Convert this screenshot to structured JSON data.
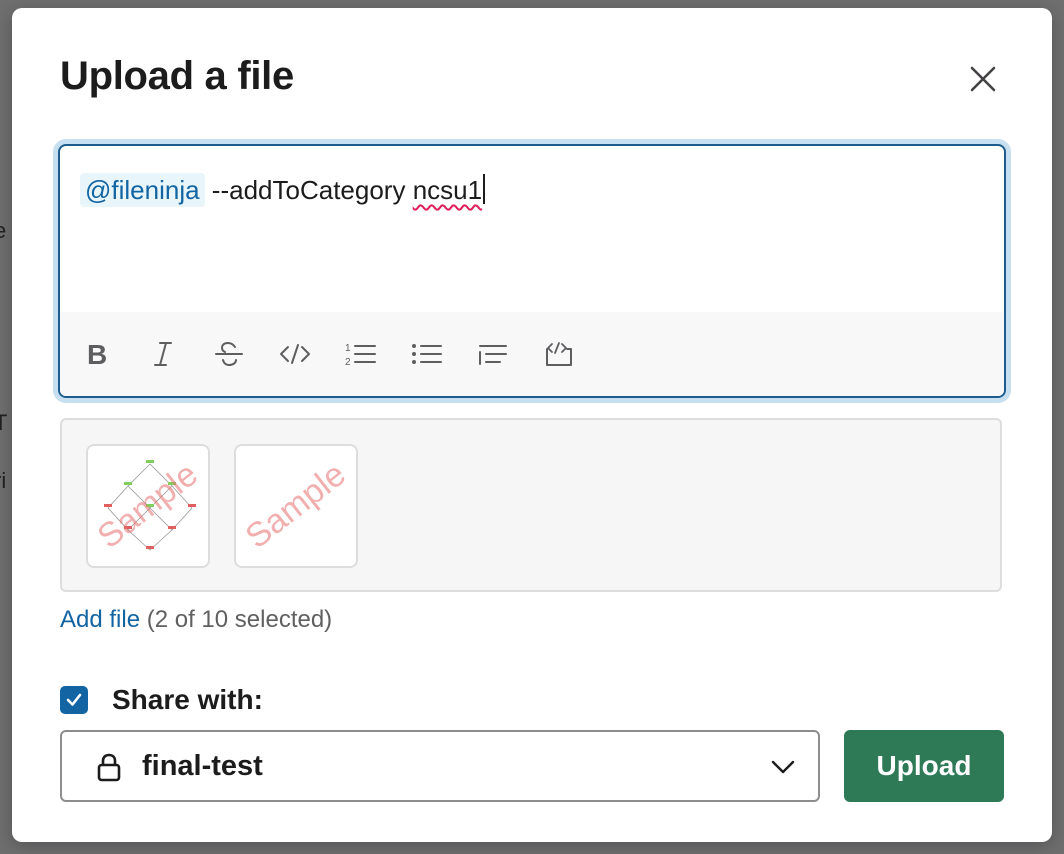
{
  "modal": {
    "title": "Upload a file",
    "close_icon": "close-icon"
  },
  "background_fragments": [
    "e",
    "T",
    "ri"
  ],
  "composer": {
    "mention": "@fileninja",
    "text": "--addToCategory",
    "misspelled": "ncsu1",
    "toolbar": [
      {
        "name": "bold-button",
        "icon": "bold-icon"
      },
      {
        "name": "italic-button",
        "icon": "italic-icon"
      },
      {
        "name": "strikethrough-button",
        "icon": "strikethrough-icon"
      },
      {
        "name": "code-button",
        "icon": "code-icon"
      },
      {
        "name": "ordered-list-button",
        "icon": "ordered-list-icon"
      },
      {
        "name": "bulleted-list-button",
        "icon": "bulleted-list-icon"
      },
      {
        "name": "blockquote-button",
        "icon": "blockquote-icon"
      },
      {
        "name": "code-block-button",
        "icon": "code-block-icon"
      }
    ]
  },
  "files": {
    "thumbnails": [
      {
        "watermark": "Sample"
      },
      {
        "watermark": "Sample"
      }
    ],
    "add_file_label": "Add file",
    "count_label": "(2 of 10 selected)"
  },
  "share": {
    "checked": true,
    "label": "Share with:",
    "channel": "final-test"
  },
  "actions": {
    "upload_label": "Upload"
  },
  "colors": {
    "accent": "#1264a3",
    "upload_button": "#2e7a56",
    "focus_ring": "#c6dff1"
  }
}
